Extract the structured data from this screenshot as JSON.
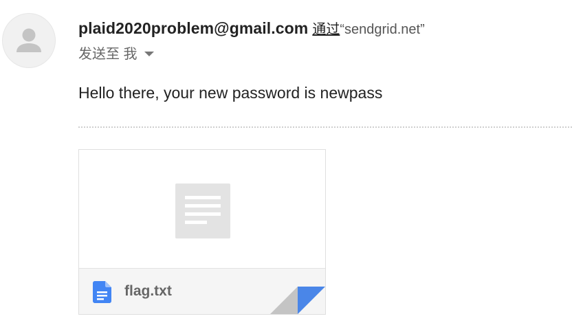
{
  "email": {
    "sender_address": "plaid2020problem@gmail.com",
    "via_label": "通过",
    "via_domain": "“sendgrid.net”",
    "recipient_label": "发送至 我",
    "body": "Hello there, your new password is newpass"
  },
  "attachment": {
    "filename": "flag.txt",
    "file_icon": "google-docs-icon",
    "preview_icon": "document-lines-icon"
  },
  "icons": {
    "avatar": "default-avatar-icon",
    "recipient_caret": "caret-down-icon",
    "corner": "page-corner-fold-icon"
  },
  "colors": {
    "file_icon_blue": "#4285f4",
    "corner_blue": "#4a86e8",
    "text_dark": "#222222",
    "text_muted": "#666666"
  }
}
